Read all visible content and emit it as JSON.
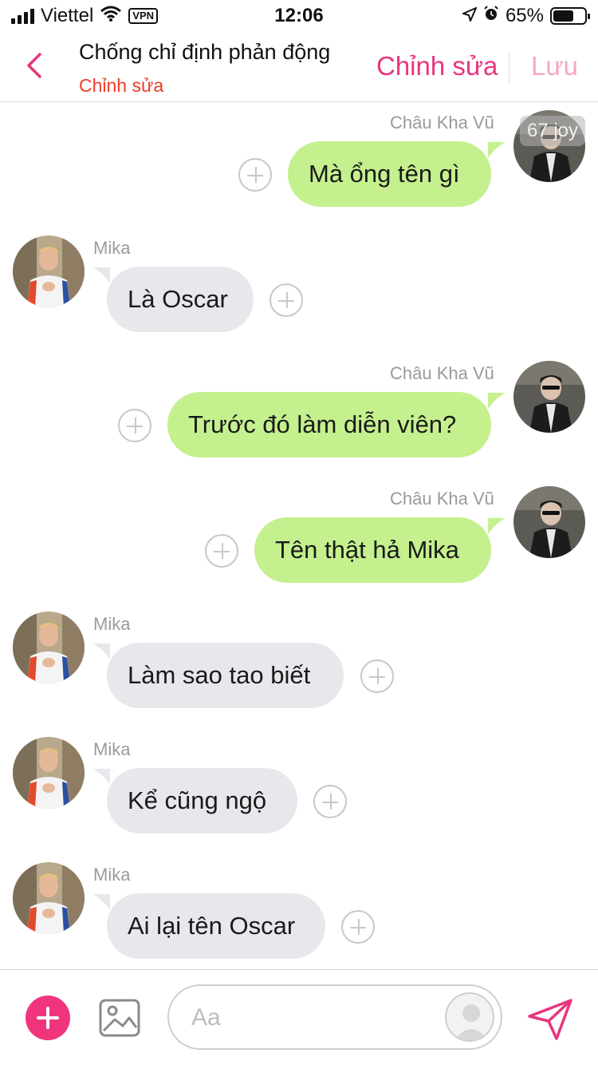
{
  "status_bar": {
    "carrier": "Viettel",
    "vpn_label": "VPN",
    "time": "12:06",
    "battery_percent": "65%",
    "battery_level": 0.65
  },
  "header": {
    "title": "Chống chỉ định phản động",
    "subtitle": "Chỉnh sửa",
    "edit_label": "Chỉnh sửa",
    "save_label": "Lưu"
  },
  "watermark": "67 joy",
  "messages": [
    {
      "sender": "Châu Kha Vũ",
      "text": "Mà ổng tên gì",
      "direction": "out"
    },
    {
      "sender": "Mika",
      "text": "Là Oscar",
      "direction": "in"
    },
    {
      "sender": "Châu Kha Vũ",
      "text": "Trước đó làm diễn viên?",
      "direction": "out"
    },
    {
      "sender": "Châu Kha Vũ",
      "text": "Tên thật hả Mika",
      "direction": "out"
    },
    {
      "sender": "Mika",
      "text": "Làm sao tao biết",
      "direction": "in"
    },
    {
      "sender": "Mika",
      "text": "Kể cũng ngộ",
      "direction": "in"
    },
    {
      "sender": "Mika",
      "text": "Ai lại tên Oscar",
      "direction": "in"
    }
  ],
  "input": {
    "placeholder": "Aa"
  },
  "colors": {
    "accent": "#e8357e",
    "subtitle": "#ee3c24",
    "outgoing_bubble": "#c5f08e",
    "incoming_bubble": "#e6e8ec"
  },
  "icons": {
    "back": "chevron-left-icon",
    "add": "plus-icon",
    "image": "image-icon",
    "send": "send-icon",
    "reaction": "add-reaction-icon"
  }
}
